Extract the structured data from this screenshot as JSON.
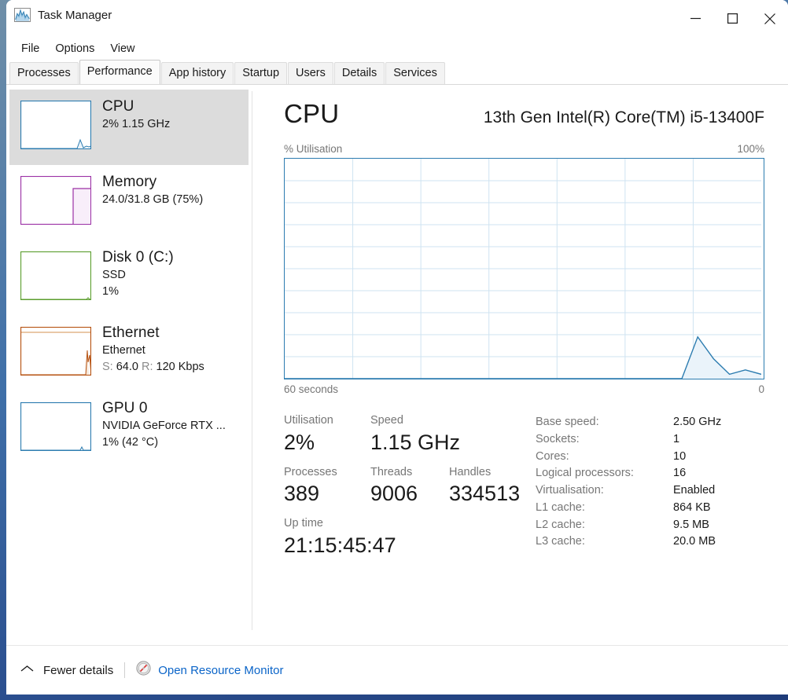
{
  "window": {
    "title": "Task Manager",
    "app_icon": "chart-icon",
    "controls": {
      "minimize": "minimize-icon",
      "maximize": "maximize-icon",
      "close": "close-icon"
    }
  },
  "menu": {
    "items": [
      "File",
      "Options",
      "View"
    ]
  },
  "tabs": [
    {
      "label": "Processes",
      "active": false
    },
    {
      "label": "Performance",
      "active": true
    },
    {
      "label": "App history",
      "active": false
    },
    {
      "label": "Startup",
      "active": false
    },
    {
      "label": "Users",
      "active": false
    },
    {
      "label": "Details",
      "active": false
    },
    {
      "label": "Services",
      "active": false
    }
  ],
  "sidebar": {
    "items": [
      {
        "name": "CPU",
        "lines": [
          "2%  1.15 GHz"
        ],
        "color": "#2c7cb0",
        "selected": true
      },
      {
        "name": "Memory",
        "lines": [
          "24.0/31.8 GB (75%)"
        ],
        "color": "#9b30a5",
        "selected": false
      },
      {
        "name": "Disk 0 (C:)",
        "lines": [
          "SSD",
          "1%"
        ],
        "color": "#5c9e2e",
        "selected": false
      },
      {
        "name": "Ethernet",
        "lines": [
          "Ethernet"
        ],
        "send_label": "S:",
        "send_value": "64.0",
        "recv_label": "R:",
        "recv_value": "120 Kbps",
        "color": "#b5500f",
        "selected": false
      },
      {
        "name": "GPU 0",
        "lines": [
          "NVIDIA GeForce RTX ...",
          "1%  (42 °C)"
        ],
        "color": "#2c7cb0",
        "selected": false
      }
    ]
  },
  "main": {
    "title": "CPU",
    "model": "13th Gen Intel(R) Core(TM) i5-13400F",
    "graph_label_left": "% Utilisation",
    "graph_label_right": "100%",
    "graph_foot_left": "60 seconds",
    "graph_foot_right": "0",
    "graph_color": "#2c7cb0",
    "stats": {
      "utilisation_label": "Utilisation",
      "utilisation_value": "2%",
      "speed_label": "Speed",
      "speed_value": "1.15 GHz",
      "processes_label": "Processes",
      "processes_value": "389",
      "threads_label": "Threads",
      "threads_value": "9006",
      "handles_label": "Handles",
      "handles_value": "334513",
      "uptime_label": "Up time",
      "uptime_value": "21:15:45:47"
    },
    "specs": [
      {
        "key": "Base speed:",
        "value": "2.50 GHz"
      },
      {
        "key": "Sockets:",
        "value": "1"
      },
      {
        "key": "Cores:",
        "value": "10"
      },
      {
        "key": "Logical processors:",
        "value": "16"
      },
      {
        "key": "Virtualisation:",
        "value": "Enabled"
      },
      {
        "key": "L1 cache:",
        "value": "864 KB"
      },
      {
        "key": "L2 cache:",
        "value": "9.5 MB"
      },
      {
        "key": "L3 cache:",
        "value": "20.0 MB"
      }
    ]
  },
  "chart_data": {
    "type": "area",
    "title": "% Utilisation",
    "xlabel": "60 seconds",
    "ylabel": "% Utilisation",
    "ylim": [
      0,
      100
    ],
    "xlim": [
      0,
      60
    ],
    "grid": true,
    "grid_rows": 10,
    "grid_cols": 7,
    "line_color": "#2c7cb0",
    "fill_color": "#eaf3fa",
    "x": [
      0,
      2,
      4,
      6,
      8,
      10,
      12,
      14,
      16,
      18,
      20,
      22,
      24,
      26,
      28,
      30,
      32,
      34,
      36,
      38,
      40,
      42,
      44,
      46,
      48,
      50,
      52,
      54,
      56,
      58,
      60
    ],
    "values": [
      0,
      0,
      0,
      0,
      0,
      0,
      0,
      0,
      0,
      0,
      0,
      0,
      0,
      0,
      0,
      0,
      0,
      0,
      0,
      0,
      0,
      0,
      0,
      0,
      0,
      0,
      19,
      9,
      2,
      4,
      2
    ]
  },
  "footer": {
    "expand_icon": "chevron-up-icon",
    "fewer_details": "Fewer details",
    "resmon_icon": "resource-monitor-icon",
    "resmon_label": "Open Resource Monitor"
  }
}
